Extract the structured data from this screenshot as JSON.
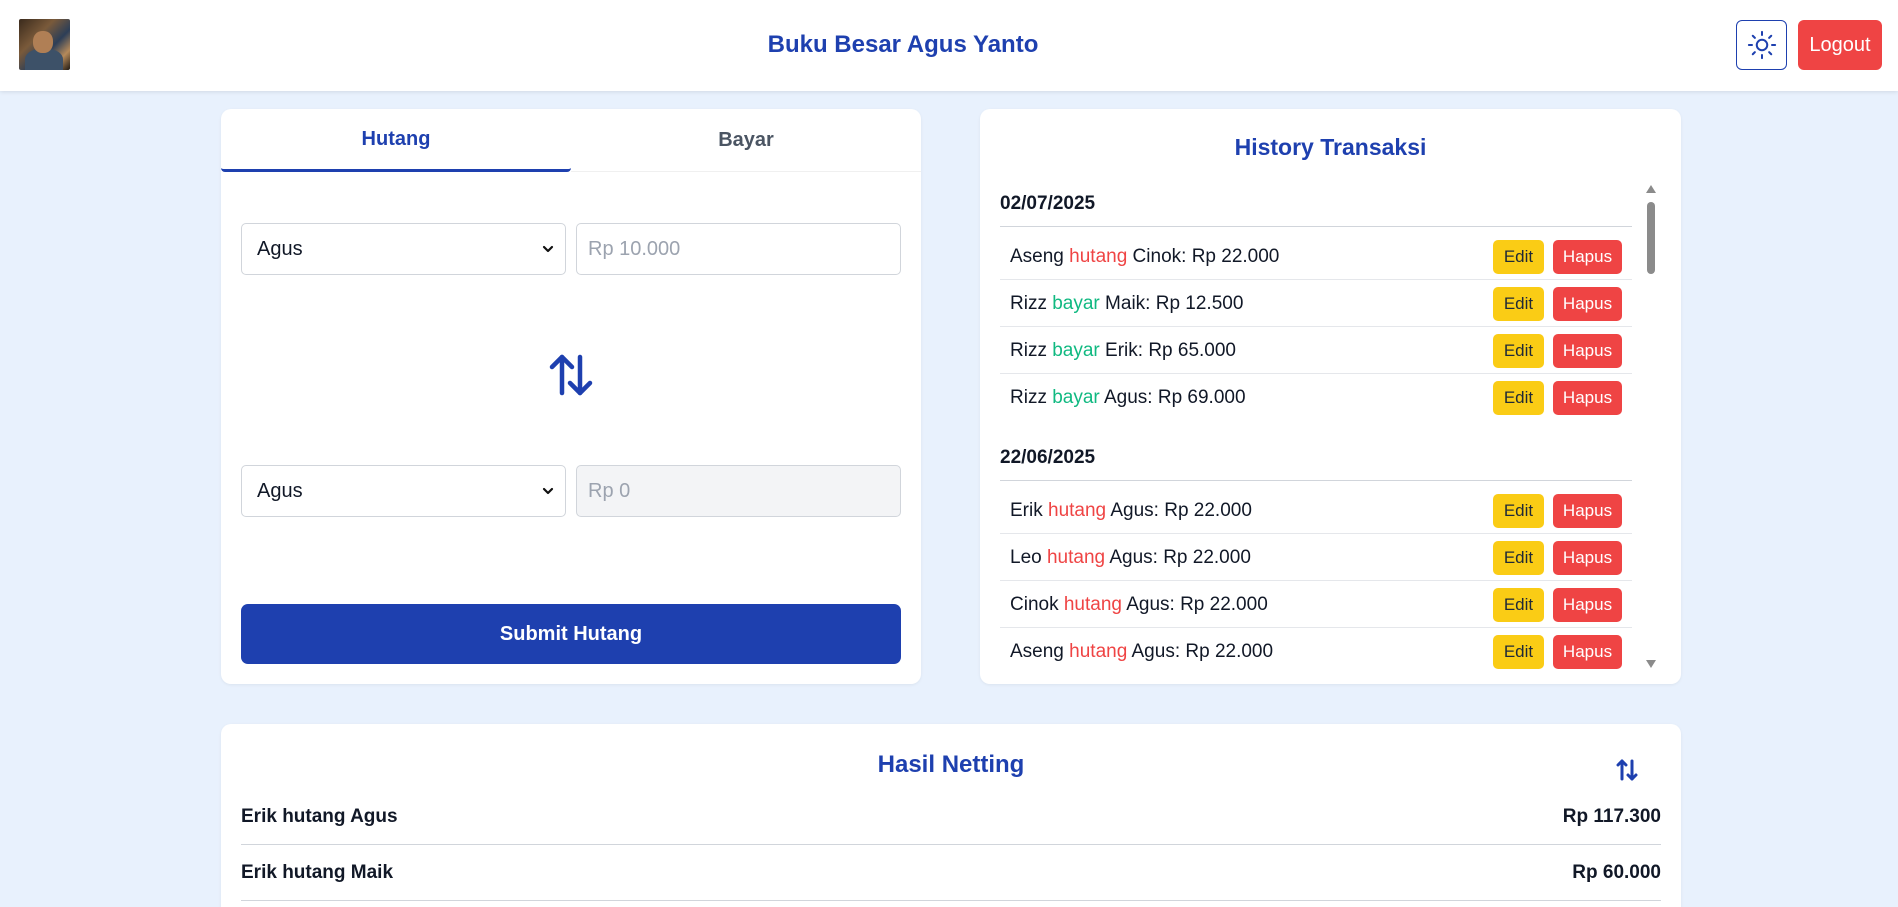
{
  "header": {
    "title": "Buku Besar Agus Yanto",
    "logout_label": "Logout",
    "theme_icon": "sun-icon"
  },
  "form": {
    "tabs": [
      {
        "label": "Hutang",
        "active": true
      },
      {
        "label": "Bayar",
        "active": false
      }
    ],
    "from_select": {
      "selected": "Agus"
    },
    "from_amount": {
      "value": "",
      "placeholder": "Rp 10.000"
    },
    "to_select": {
      "selected": "Agus"
    },
    "to_amount": {
      "value": "",
      "placeholder": "Rp 0"
    },
    "swap_icon": "swap-vertical-icon",
    "submit_label": "Submit Hutang"
  },
  "history": {
    "title": "History Transaksi",
    "edit_label": "Edit",
    "delete_label": "Hapus",
    "groups": [
      {
        "date": "02/07/2025",
        "items": [
          {
            "from": "Aseng",
            "type": "hutang",
            "rest": " Cinok: Rp 22.000"
          },
          {
            "from": "Rizz",
            "type": "bayar",
            "rest": " Maik: Rp 12.500"
          },
          {
            "from": "Rizz",
            "type": "bayar",
            "rest": " Erik: Rp 65.000"
          },
          {
            "from": "Rizz",
            "type": "bayar",
            "rest": " Agus: Rp 69.000"
          }
        ]
      },
      {
        "date": "22/06/2025",
        "items": [
          {
            "from": "Erik",
            "type": "hutang",
            "rest": " Agus: Rp 22.000"
          },
          {
            "from": "Leo",
            "type": "hutang",
            "rest": " Agus: Rp 22.000"
          },
          {
            "from": "Cinok",
            "type": "hutang",
            "rest": " Agus: Rp 22.000"
          },
          {
            "from": "Aseng",
            "type": "hutang",
            "rest": " Agus: Rp 22.000"
          }
        ]
      }
    ]
  },
  "netting": {
    "title": "Hasil Netting",
    "sort_icon": "sort-icon",
    "rows": [
      {
        "label": "Erik hutang Agus",
        "amount": "Rp 117.300"
      },
      {
        "label": "Erik hutang Maik",
        "amount": "Rp 60.000"
      }
    ]
  },
  "colors": {
    "primary": "#1e40af",
    "danger": "#ef4444",
    "warning": "#facc15",
    "success": "#10b981",
    "background": "#e8f1fd"
  }
}
